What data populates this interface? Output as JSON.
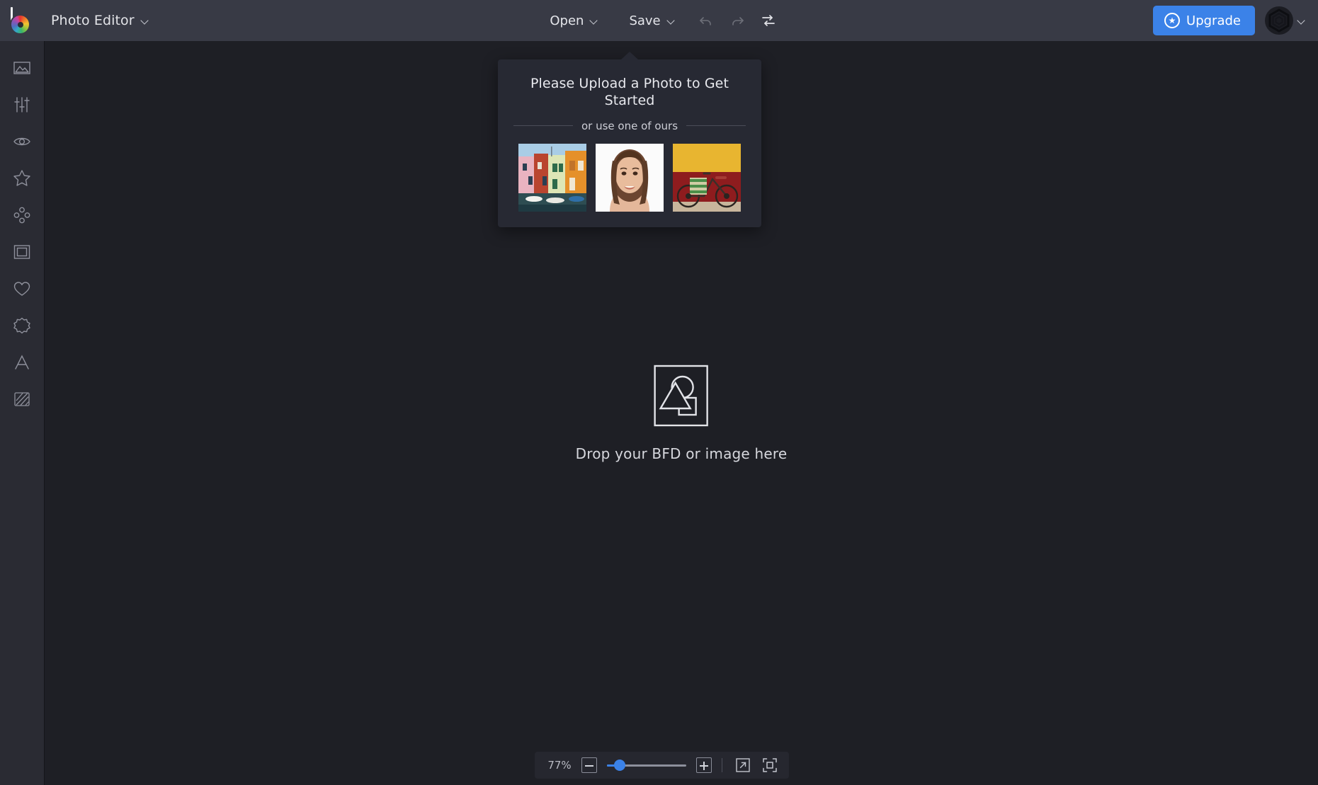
{
  "header": {
    "logo_name": "befunky-logo",
    "app_title": "Photo Editor",
    "open_label": "Open",
    "save_label": "Save",
    "undo_name": "undo-icon",
    "redo_name": "redo-icon",
    "compare_name": "compare-swap-icon",
    "upgrade_label": "Upgrade",
    "upgrade_color": "#3b82e8",
    "avatar_name": "account-avatar"
  },
  "sidebar": {
    "items": [
      {
        "id": "image",
        "label": "Image",
        "icon": "image-mountain-icon"
      },
      {
        "id": "edit",
        "label": "Edit",
        "icon": "sliders-icon"
      },
      {
        "id": "touchup",
        "label": "Touch Up",
        "icon": "eye-icon"
      },
      {
        "id": "effects",
        "label": "Effects",
        "icon": "star-icon"
      },
      {
        "id": "artsy",
        "label": "Artsy",
        "icon": "four-dots-icon"
      },
      {
        "id": "frames",
        "label": "Frames",
        "icon": "frame-icon"
      },
      {
        "id": "overlays",
        "label": "Overlays",
        "icon": "heart-icon"
      },
      {
        "id": "graphics",
        "label": "Graphics",
        "icon": "badge-starburst-icon"
      },
      {
        "id": "text",
        "label": "Text",
        "icon": "letter-a-icon"
      },
      {
        "id": "textures",
        "label": "Textures",
        "icon": "diagonal-stripes-icon"
      }
    ]
  },
  "popup": {
    "title": "Please Upload a Photo to Get Started",
    "subtitle": "or use one of ours",
    "samples": [
      {
        "id": "sample-burano-houses",
        "alt": "Colorful canal houses"
      },
      {
        "id": "sample-portrait",
        "alt": "Smiling woman portrait"
      },
      {
        "id": "sample-bicycle",
        "alt": "Bicycle against yellow and red wall"
      }
    ]
  },
  "canvas": {
    "dropzone_icon": "shapes-placeholder-icon",
    "dropzone_text": "Drop your BFD or image here",
    "background_color": "#1e1f25"
  },
  "zoombar": {
    "zoom_level": "77%",
    "zoom_out_name": "zoom-out-button",
    "zoom_in_name": "zoom-in-button",
    "slider_name": "zoom-slider",
    "slider_percent": 16,
    "expand_name": "expand-view-icon",
    "fit_name": "fit-to-screen-icon",
    "accent_color": "#3b82e8"
  }
}
